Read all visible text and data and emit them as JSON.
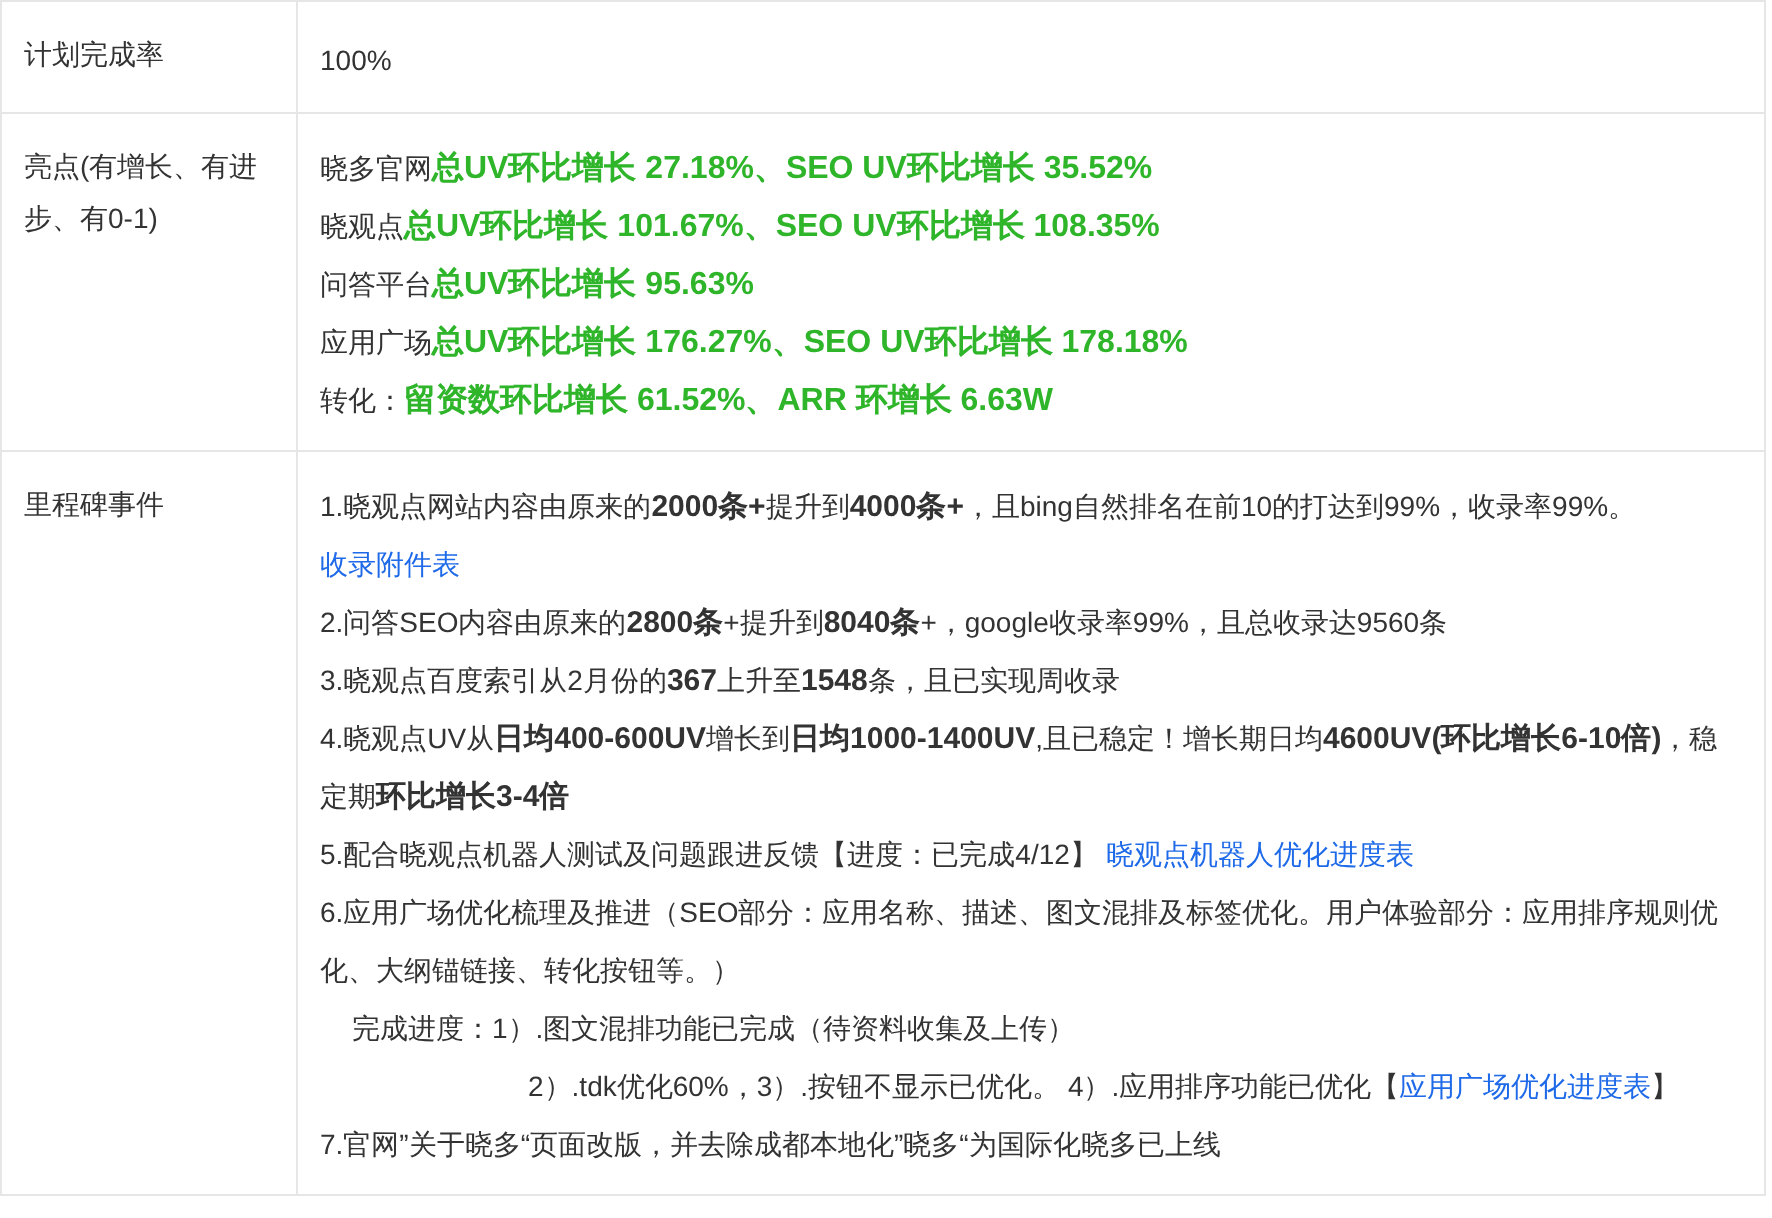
{
  "rows": [
    {
      "label": "计划完成率",
      "kind": "text",
      "text": "100%"
    },
    {
      "label": "亮点(有增长、有进步、有0-1)",
      "kind": "highlights",
      "lines": [
        {
          "prefix": "晓多官网",
          "value": "总UV环比增长 27.18%、SEO UV环比增长 35.52%"
        },
        {
          "prefix": "晓观点",
          "value": "总UV环比增长 101.67%、SEO UV环比增长 108.35%"
        },
        {
          "prefix": "问答平台",
          "value": "总UV环比增长 95.63%"
        },
        {
          "prefix": "应用广场",
          "value": "总UV环比增长 176.27%、SEO UV环比增长 178.18%"
        },
        {
          "prefix": "转化：",
          "value": "留资数环比增长 61.52%、ARR 环增长 6.63W"
        }
      ]
    },
    {
      "label": "里程碑事件",
      "kind": "milestones",
      "items": [
        {
          "kind": "item",
          "text": "1.晓观点网站内容由原来的**2000条+**提升到**4000条+**，且bing自然排名在前10的打达到99%，收录率99%。 ",
          "link": "收录附件表"
        },
        {
          "kind": "item",
          "text": "2.问答SEO内容由原来的**2800条**+提升到**8040条**+，google收录率99%，且总收录达9560条"
        },
        {
          "kind": "item",
          "text": "3.晓观点百度索引从2月份的**367**上升至**1548**条，且已实现周收录"
        },
        {
          "kind": "item",
          "text": "4.晓观点UV从**日均400-600UV**增长到**日均1000-1400UV**,且已稳定！增长期日均**4600UV(环比增长6-10倍)**，稳定期**环比增长3-4倍**"
        },
        {
          "kind": "item",
          "text": "5.配合晓观点机器人测试及问题跟进反馈【进度：已完成4/12】 ",
          "link": "晓观点机器人优化进度表"
        },
        {
          "kind": "item",
          "text": "6.应用广场优化梳理及推进（SEO部分：应用名称、描述、图文混排及标签优化。用户体验部分：应用排序规则优化、大纲锚链接、转化按钮等。）"
        },
        {
          "kind": "progress",
          "text": "完成进度：1）.图文混排功能已完成（待资料收集及上传）"
        },
        {
          "kind": "progress-cont",
          "text": "2）.tdk优化60%，3）.按钮不显示已优化。 4）.应用排序功能已优化【",
          "link": "应用广场优化进度表",
          "after": "】"
        },
        {
          "kind": "item",
          "text": "7.官网”关于晓多“页面改版，并去除成都本地化”晓多“为国际化晓多已上线"
        }
      ]
    }
  ]
}
